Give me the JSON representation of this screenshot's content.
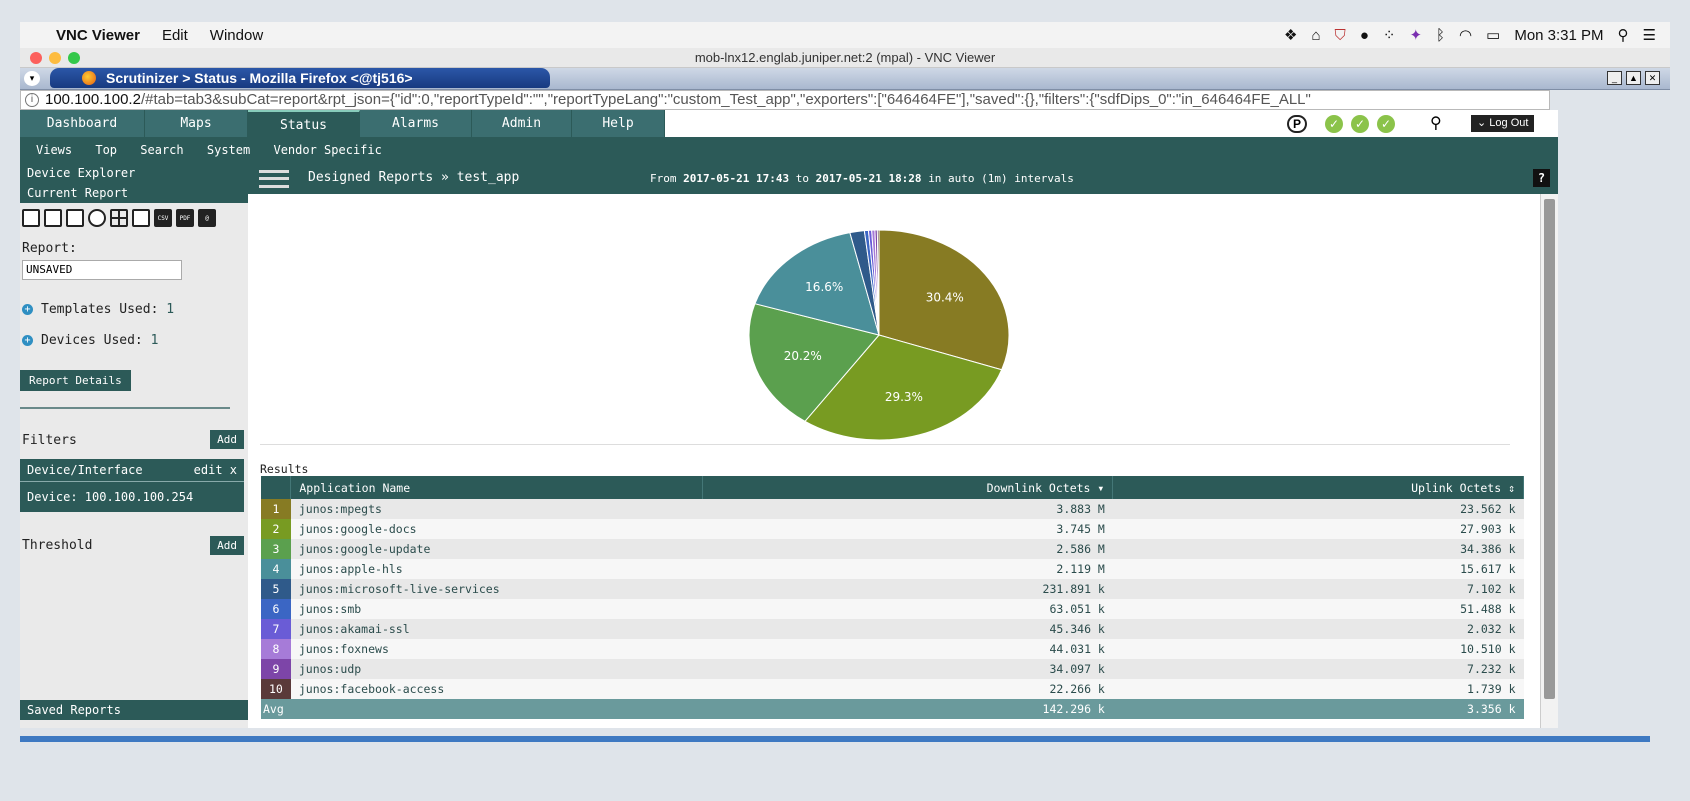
{
  "mac_menubar": {
    "app": "VNC Viewer",
    "menus": [
      "Edit",
      "Window"
    ],
    "clock": "Mon 3:31 PM"
  },
  "vnc": {
    "title": "mob-lnx12.englab.juniper.net:2 (mpal) - VNC Viewer"
  },
  "firefox": {
    "tab_title": "Scrutinizer > Status - Mozilla Firefox <@tj516>",
    "url_host": "100.100.100.2",
    "url_rest": "/#tab=tab3&subCat=report&rpt_json={\"id\":0,\"reportTypeId\":\"\",\"reportTypeLang\":\"custom_Test_app\",\"exporters\":[\"646464FE\"],\"saved\":{},\"filters\":{\"sdfDips_0\":\"in_646464FE_ALL\""
  },
  "nav": {
    "tabs": [
      "Dashboard",
      "Maps",
      "Status",
      "Alarms",
      "Admin",
      "Help"
    ],
    "active_tab": "Status",
    "subnav": [
      "Views",
      "Top",
      "Search",
      "System",
      "Vendor Specific"
    ],
    "logout": "Log Out"
  },
  "sidebar": {
    "device_explorer": "Device Explorer",
    "current_report": "Current Report",
    "report_label": "Report:",
    "report_value": "UNSAVED",
    "templates_used": "Templates Used:",
    "templates_count": "1",
    "devices_used": "Devices Used:",
    "devices_count": "1",
    "report_details": "Report Details",
    "filters_label": "Filters",
    "add": "Add",
    "filter_header": "Device/Interface",
    "filter_edit": "edit x",
    "filter_value": "Device: 100.100.100.254",
    "threshold_label": "Threshold",
    "saved_reports": "Saved Reports"
  },
  "report_header": {
    "breadcrumb": "Designed Reports » test_app",
    "from_label": "From",
    "from": "2017-05-21 17:43",
    "to_label": "to",
    "to": "2017-05-21 18:28",
    "interval": "in auto (1m) intervals",
    "help": "?"
  },
  "chart_data": {
    "type": "pie",
    "categories": [
      "junos:mpegts",
      "junos:google-docs",
      "junos:google-update",
      "junos:apple-hls",
      "junos:microsoft-live-services",
      "junos:smb",
      "junos:akamai-ssl",
      "junos:foxnews",
      "junos:udp",
      "junos:facebook-access"
    ],
    "values": [
      30.4,
      29.3,
      20.2,
      16.6,
      1.8,
      0.5,
      0.4,
      0.4,
      0.3,
      0.2
    ],
    "labels_shown": [
      "30.4%",
      "29.3%",
      "20.2%",
      "16.6%"
    ],
    "colors": [
      "#877b23",
      "#789b22",
      "#5ba04e",
      "#4a8f9a",
      "#2f5a8a",
      "#3b66c4",
      "#6a5cd6",
      "#a67bd8",
      "#7d45a8",
      "#5a3a3a"
    ]
  },
  "results": {
    "title": "Results",
    "columns": [
      "Application Name",
      "Downlink Octets",
      "Uplink Octets"
    ],
    "rows": [
      {
        "idx": "1",
        "name": "junos:mpegts",
        "down": "3.883 M",
        "up": "23.562 k"
      },
      {
        "idx": "2",
        "name": "junos:google-docs",
        "down": "3.745 M",
        "up": "27.903 k"
      },
      {
        "idx": "3",
        "name": "junos:google-update",
        "down": "2.586 M",
        "up": "34.386 k"
      },
      {
        "idx": "4",
        "name": "junos:apple-hls",
        "down": "2.119 M",
        "up": "15.617 k"
      },
      {
        "idx": "5",
        "name": "junos:microsoft-live-services",
        "down": "231.891 k",
        "up": "7.102 k"
      },
      {
        "idx": "6",
        "name": "junos:smb",
        "down": "63.051 k",
        "up": "51.488 k"
      },
      {
        "idx": "7",
        "name": "junos:akamai-ssl",
        "down": "45.346 k",
        "up": "2.032 k"
      },
      {
        "idx": "8",
        "name": "junos:foxnews",
        "down": "44.031 k",
        "up": "10.510 k"
      },
      {
        "idx": "9",
        "name": "junos:udp",
        "down": "34.097 k",
        "up": "7.232 k"
      },
      {
        "idx": "10",
        "name": "junos:facebook-access",
        "down": "22.266 k",
        "up": "1.739 k"
      }
    ],
    "avg_label": "Avg",
    "avg_down": "142.296 k",
    "avg_up": "3.356 k"
  }
}
